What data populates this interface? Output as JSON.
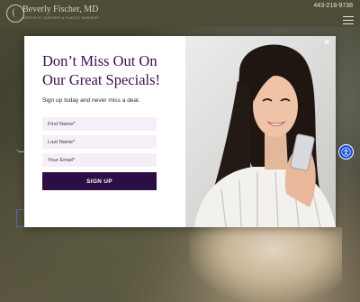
{
  "header": {
    "brand_name": "Beverly Fischer, MD",
    "brand_subtitle": "AESTHETIC SURGERY & PLASTIC SURGERY",
    "phone": "443-218-9738"
  },
  "popup": {
    "title": "Don’t Miss Out On Our Great Specials!",
    "subtitle": "Sign up today and never miss a deal.",
    "fields": {
      "first_name_placeholder": "First Name*",
      "last_name_placeholder": "Last Name*",
      "email_placeholder": "Your Email*"
    },
    "submit_label": "SIGN UP",
    "close_label": "×"
  },
  "icons": {
    "logo": "logo-mark-icon",
    "menu": "hamburger-menu-icon",
    "close": "close-icon",
    "accessibility": "accessibility-icon",
    "phone": "smartphone-icon"
  },
  "colors": {
    "header_bg": "#4d4c36",
    "title_color": "#3a0f4f",
    "button_bg": "#2c0d45",
    "field_bg": "#f6eff9",
    "accessibility_bg": "#1a4fd6"
  }
}
